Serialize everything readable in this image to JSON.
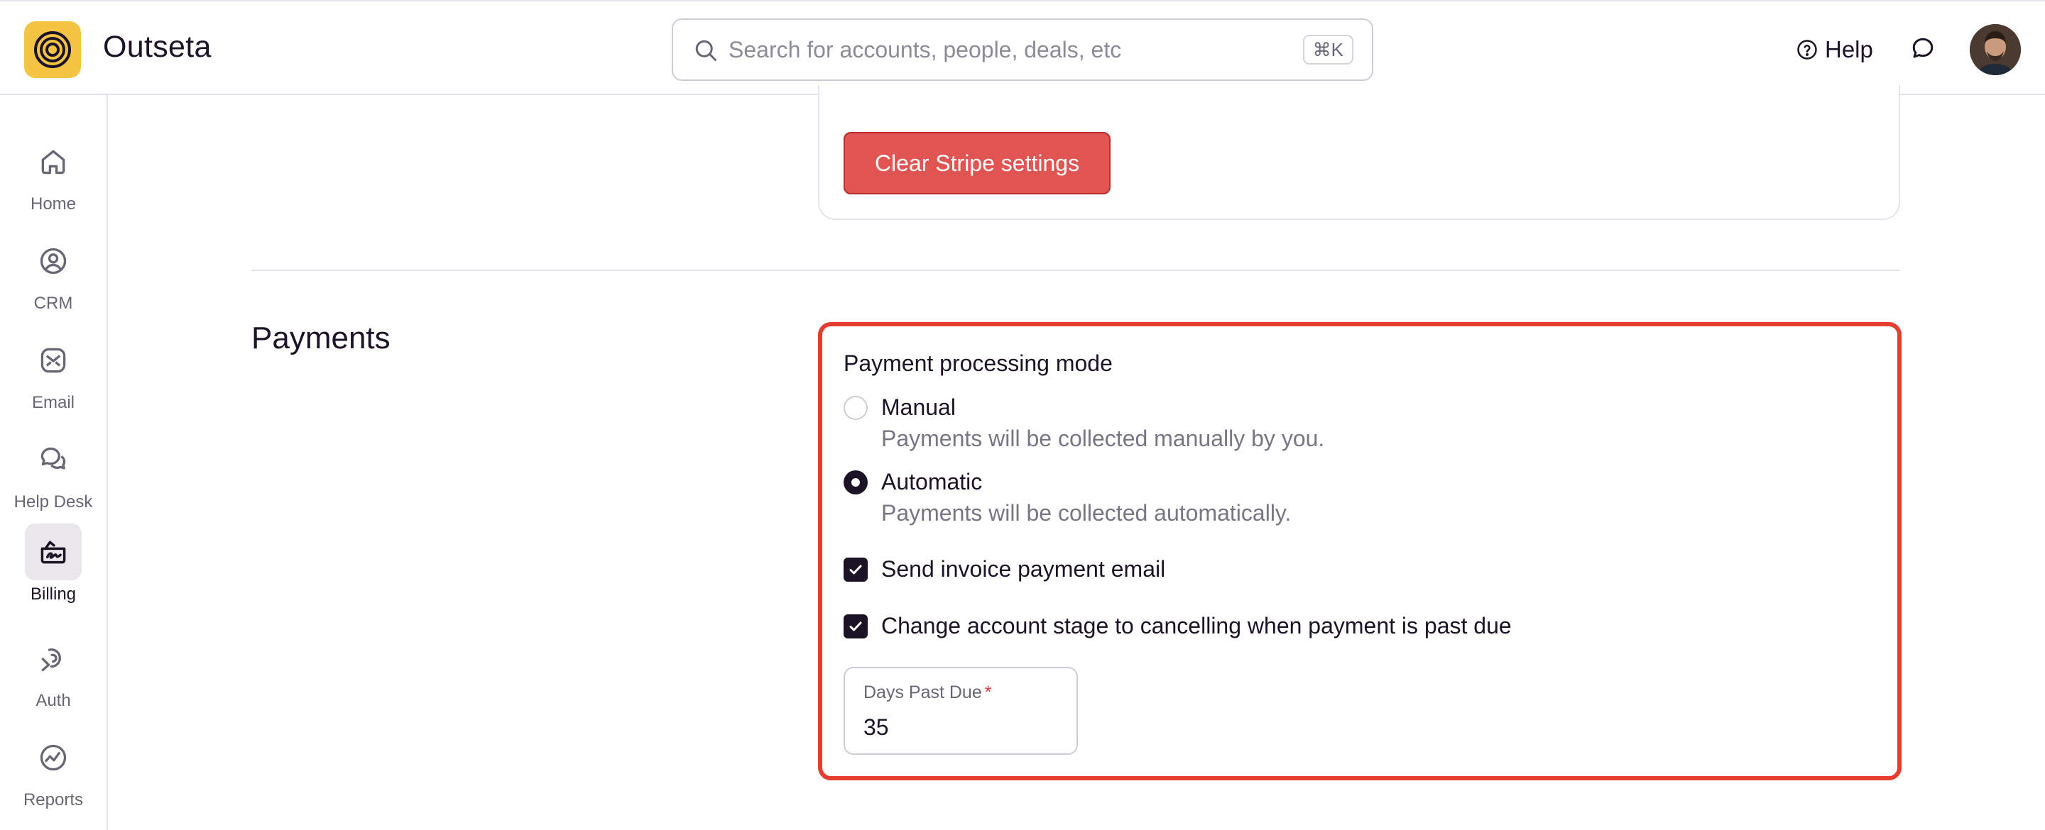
{
  "app": {
    "name": "Outseta"
  },
  "search": {
    "placeholder": "Search for accounts, people, deals, etc",
    "shortcut": "⌘K"
  },
  "header": {
    "help_label": "Help"
  },
  "sidebar": {
    "items": [
      {
        "label": "Home",
        "icon": "home-icon",
        "active": false
      },
      {
        "label": "CRM",
        "icon": "user-circle-icon",
        "active": false
      },
      {
        "label": "Email",
        "icon": "email-icon",
        "active": false
      },
      {
        "label": "Help Desk",
        "icon": "chat-bubbles-icon",
        "active": false
      },
      {
        "label": "Billing",
        "icon": "billing-icon",
        "active": true
      },
      {
        "label": "Auth",
        "icon": "auth-icon",
        "active": false
      },
      {
        "label": "Reports",
        "icon": "reports-icon",
        "active": false
      }
    ]
  },
  "stripe": {
    "clear_button_label": "Clear Stripe settings"
  },
  "payments": {
    "section_title": "Payments",
    "mode_label": "Payment processing mode",
    "options": [
      {
        "title": "Manual",
        "description": "Payments will be collected manually by you.",
        "selected": false
      },
      {
        "title": "Automatic",
        "description": "Payments will be collected automatically.",
        "selected": true
      }
    ],
    "send_invoice_email": {
      "label": "Send invoice payment email",
      "checked": true
    },
    "change_stage": {
      "label": "Change account stage to cancelling when payment is past due",
      "checked": true
    },
    "days_past_due": {
      "label": "Days Past Due",
      "required_mark": "*",
      "value": "35"
    }
  },
  "colors": {
    "accent_dark": "#1c1326",
    "logo_yellow": "#f6c443",
    "danger_button": "#e05452",
    "highlight_border": "#e53e2f"
  }
}
